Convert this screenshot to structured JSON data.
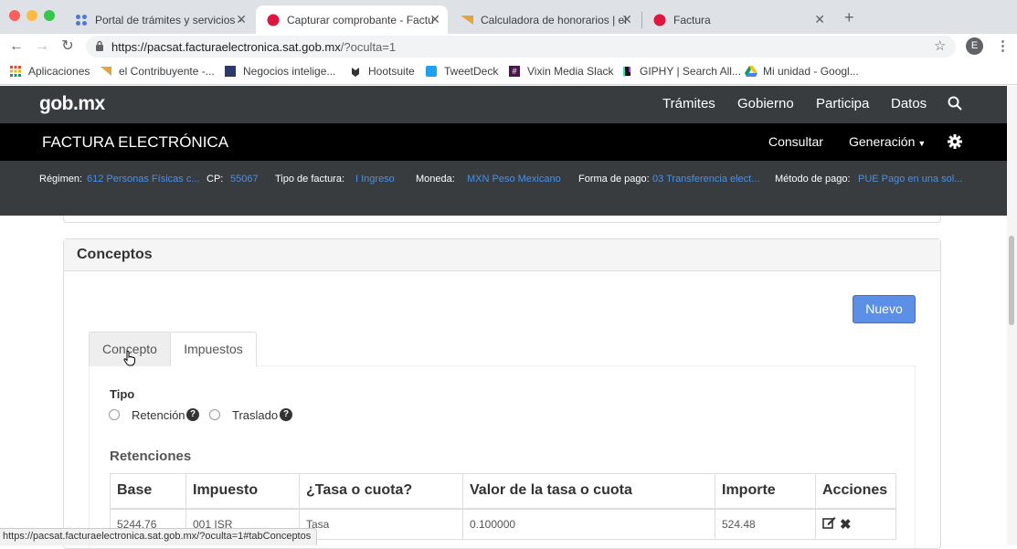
{
  "browser": {
    "tabs": [
      {
        "title": "Portal de trámites y servicios -",
        "icon": "grid-favicon-icon",
        "active": false
      },
      {
        "title": "Capturar comprobante - Factu",
        "icon": "sat-favicon-icon",
        "active": true
      },
      {
        "title": "Calculadora de honorarios | el",
        "icon": "contribuyente-favicon-icon",
        "active": false
      },
      {
        "title": "Factura",
        "icon": "sat-favicon-icon",
        "active": false
      }
    ],
    "url_host": "https://pacsat.facturaelectronica.sat.gob.mx",
    "url_path": "/?oculta=1",
    "profile_initial": "E",
    "bookmarks": [
      "Aplicaciones",
      "el Contribuyente -...",
      "Negocios intelige...",
      "Hootsuite",
      "TweetDeck",
      "Vixin Media Slack",
      "GIPHY | Search All...",
      "Mi unidad - Googl..."
    ],
    "status_url": "https://pacsat.facturaelectronica.sat.gob.mx/?oculta=1#tabConceptos"
  },
  "gob_header": {
    "logo": "gob.mx",
    "nav": [
      "Trámites",
      "Gobierno",
      "Participa",
      "Datos"
    ]
  },
  "factura_header": {
    "title": "FACTURA ELECTRÓNICA",
    "consultar": "Consultar",
    "generacion": "Generación"
  },
  "info": {
    "regimen_label": "Régimen:",
    "regimen": "612 Personas Físicas c...",
    "cp_label": "CP:",
    "cp": "55067",
    "tipo_label": "Tipo de factura:",
    "tipo": "I Ingreso",
    "moneda_label": "Moneda:",
    "moneda": "MXN Peso Mexicano",
    "forma_label": "Forma de pago:",
    "forma": "03 Transferencia elect...",
    "metodo_label": "Método de pago:",
    "metodo": "PUE Pago en una sol..."
  },
  "conceptos": {
    "title": "Conceptos",
    "nuevo": "Nuevo",
    "tabs": [
      "Concepto",
      "Impuestos"
    ],
    "tipo_label": "Tipo",
    "radio_retencion": "Retención",
    "radio_traslado": "Traslado",
    "retenciones_title": "Retenciones",
    "table": {
      "headers": [
        "Base",
        "Impuesto",
        "¿Tasa o cuota?",
        "Valor de la tasa o cuota",
        "Importe",
        "Acciones"
      ],
      "rows": [
        [
          "5244.76",
          "001 ISR",
          "Tasa",
          "0.100000",
          "524.48"
        ]
      ]
    }
  },
  "colors": {
    "link_blue": "#4a90e2",
    "button_blue": "#5c8fe6",
    "gob_dark": "#393c3e"
  }
}
